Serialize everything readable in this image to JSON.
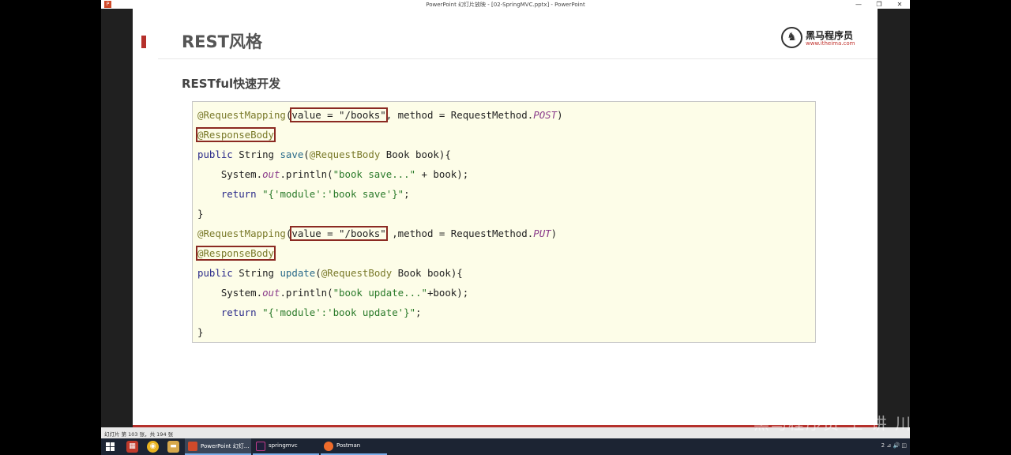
{
  "window": {
    "title": "PowerPoint 幻灯片放映 - [02-SpringMVC.pptx] - PowerPoint",
    "app_icon": "P",
    "controls": [
      "—",
      "❐",
      "✕"
    ]
  },
  "slide": {
    "title": "REST风格",
    "subtitle": "RESTful快速开发",
    "logo": {
      "name": "黑马程序员",
      "url": "www.itheima.com",
      "icon": "horse-logo-icon"
    },
    "code": {
      "l1": {
        "a": "@RequestMapping",
        "b": "(",
        "c": "value = \"/books\"",
        "d": ", method = RequestMethod.",
        "e": "POST",
        "f": ")"
      },
      "l2": {
        "a": "@ResponseBody"
      },
      "l3": {
        "a": "public",
        "b": " String ",
        "c": "save",
        "d": "(",
        "e": "@RequestBody",
        "f": " Book book){"
      },
      "l4": {
        "a": "    System.",
        "b": "out",
        "c": ".println(",
        "d": "\"book save...\"",
        "e": " + book);"
      },
      "l5": {
        "a": "    ",
        "b": "return",
        "c": " ",
        "d": "\"{'module':'book save'}\"",
        "e": ";"
      },
      "l6": {
        "a": "}"
      },
      "l7": {
        "a": "@RequestMapping",
        "b": "(",
        "c": "value = \"/books\"",
        "d": " ,method = RequestMethod.",
        "e": "PUT",
        "f": ")"
      },
      "l8": {
        "a": "@ResponseBody"
      },
      "l9": {
        "a": "public",
        "b": " String ",
        "c": "update",
        "d": "(",
        "e": "@RequestBody",
        "f": " Book book){"
      },
      "l10": {
        "a": "    System.",
        "b": "out",
        "c": ".println(",
        "d": "\"book update...\"",
        "e": "+book);"
      },
      "l11": {
        "a": "    ",
        "b": "return",
        "c": " ",
        "d": "\"{'module':'book update'}\"",
        "e": ";"
      },
      "l12": {
        "a": "}"
      }
    }
  },
  "statusbar": {
    "text": "幻灯片 第 103 张，共 194 张"
  },
  "watermark": "黑马程序员 上 讲 川",
  "taskbar": {
    "apps": [
      {
        "label": "PowerPoint 幻灯...",
        "icon": "powerpoint-icon"
      },
      {
        "label": "springmvc",
        "icon": "intellij-icon"
      },
      {
        "label": "Postman",
        "icon": "postman-icon"
      }
    ],
    "tray": "2 ⊿ 🔊 ◫"
  }
}
